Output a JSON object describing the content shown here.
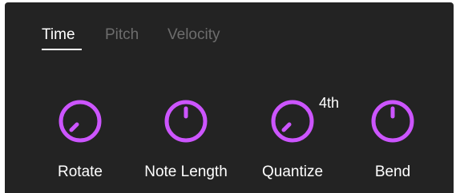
{
  "tabs": [
    {
      "label": "Time",
      "active": true
    },
    {
      "label": "Pitch",
      "active": false
    },
    {
      "label": "Velocity",
      "active": false
    }
  ],
  "knobs": [
    {
      "label": "Rotate",
      "indicator": "lower-left"
    },
    {
      "label": "Note Length",
      "indicator": "up"
    },
    {
      "label": "Quantize",
      "indicator": "lower-left",
      "value": "4th"
    },
    {
      "label": "Bend",
      "indicator": "up"
    }
  ],
  "colors": {
    "background": "#232323",
    "knob_accent": "#cc55ff",
    "text": "#ffffff",
    "inactive_tab": "#6d6d6d"
  }
}
